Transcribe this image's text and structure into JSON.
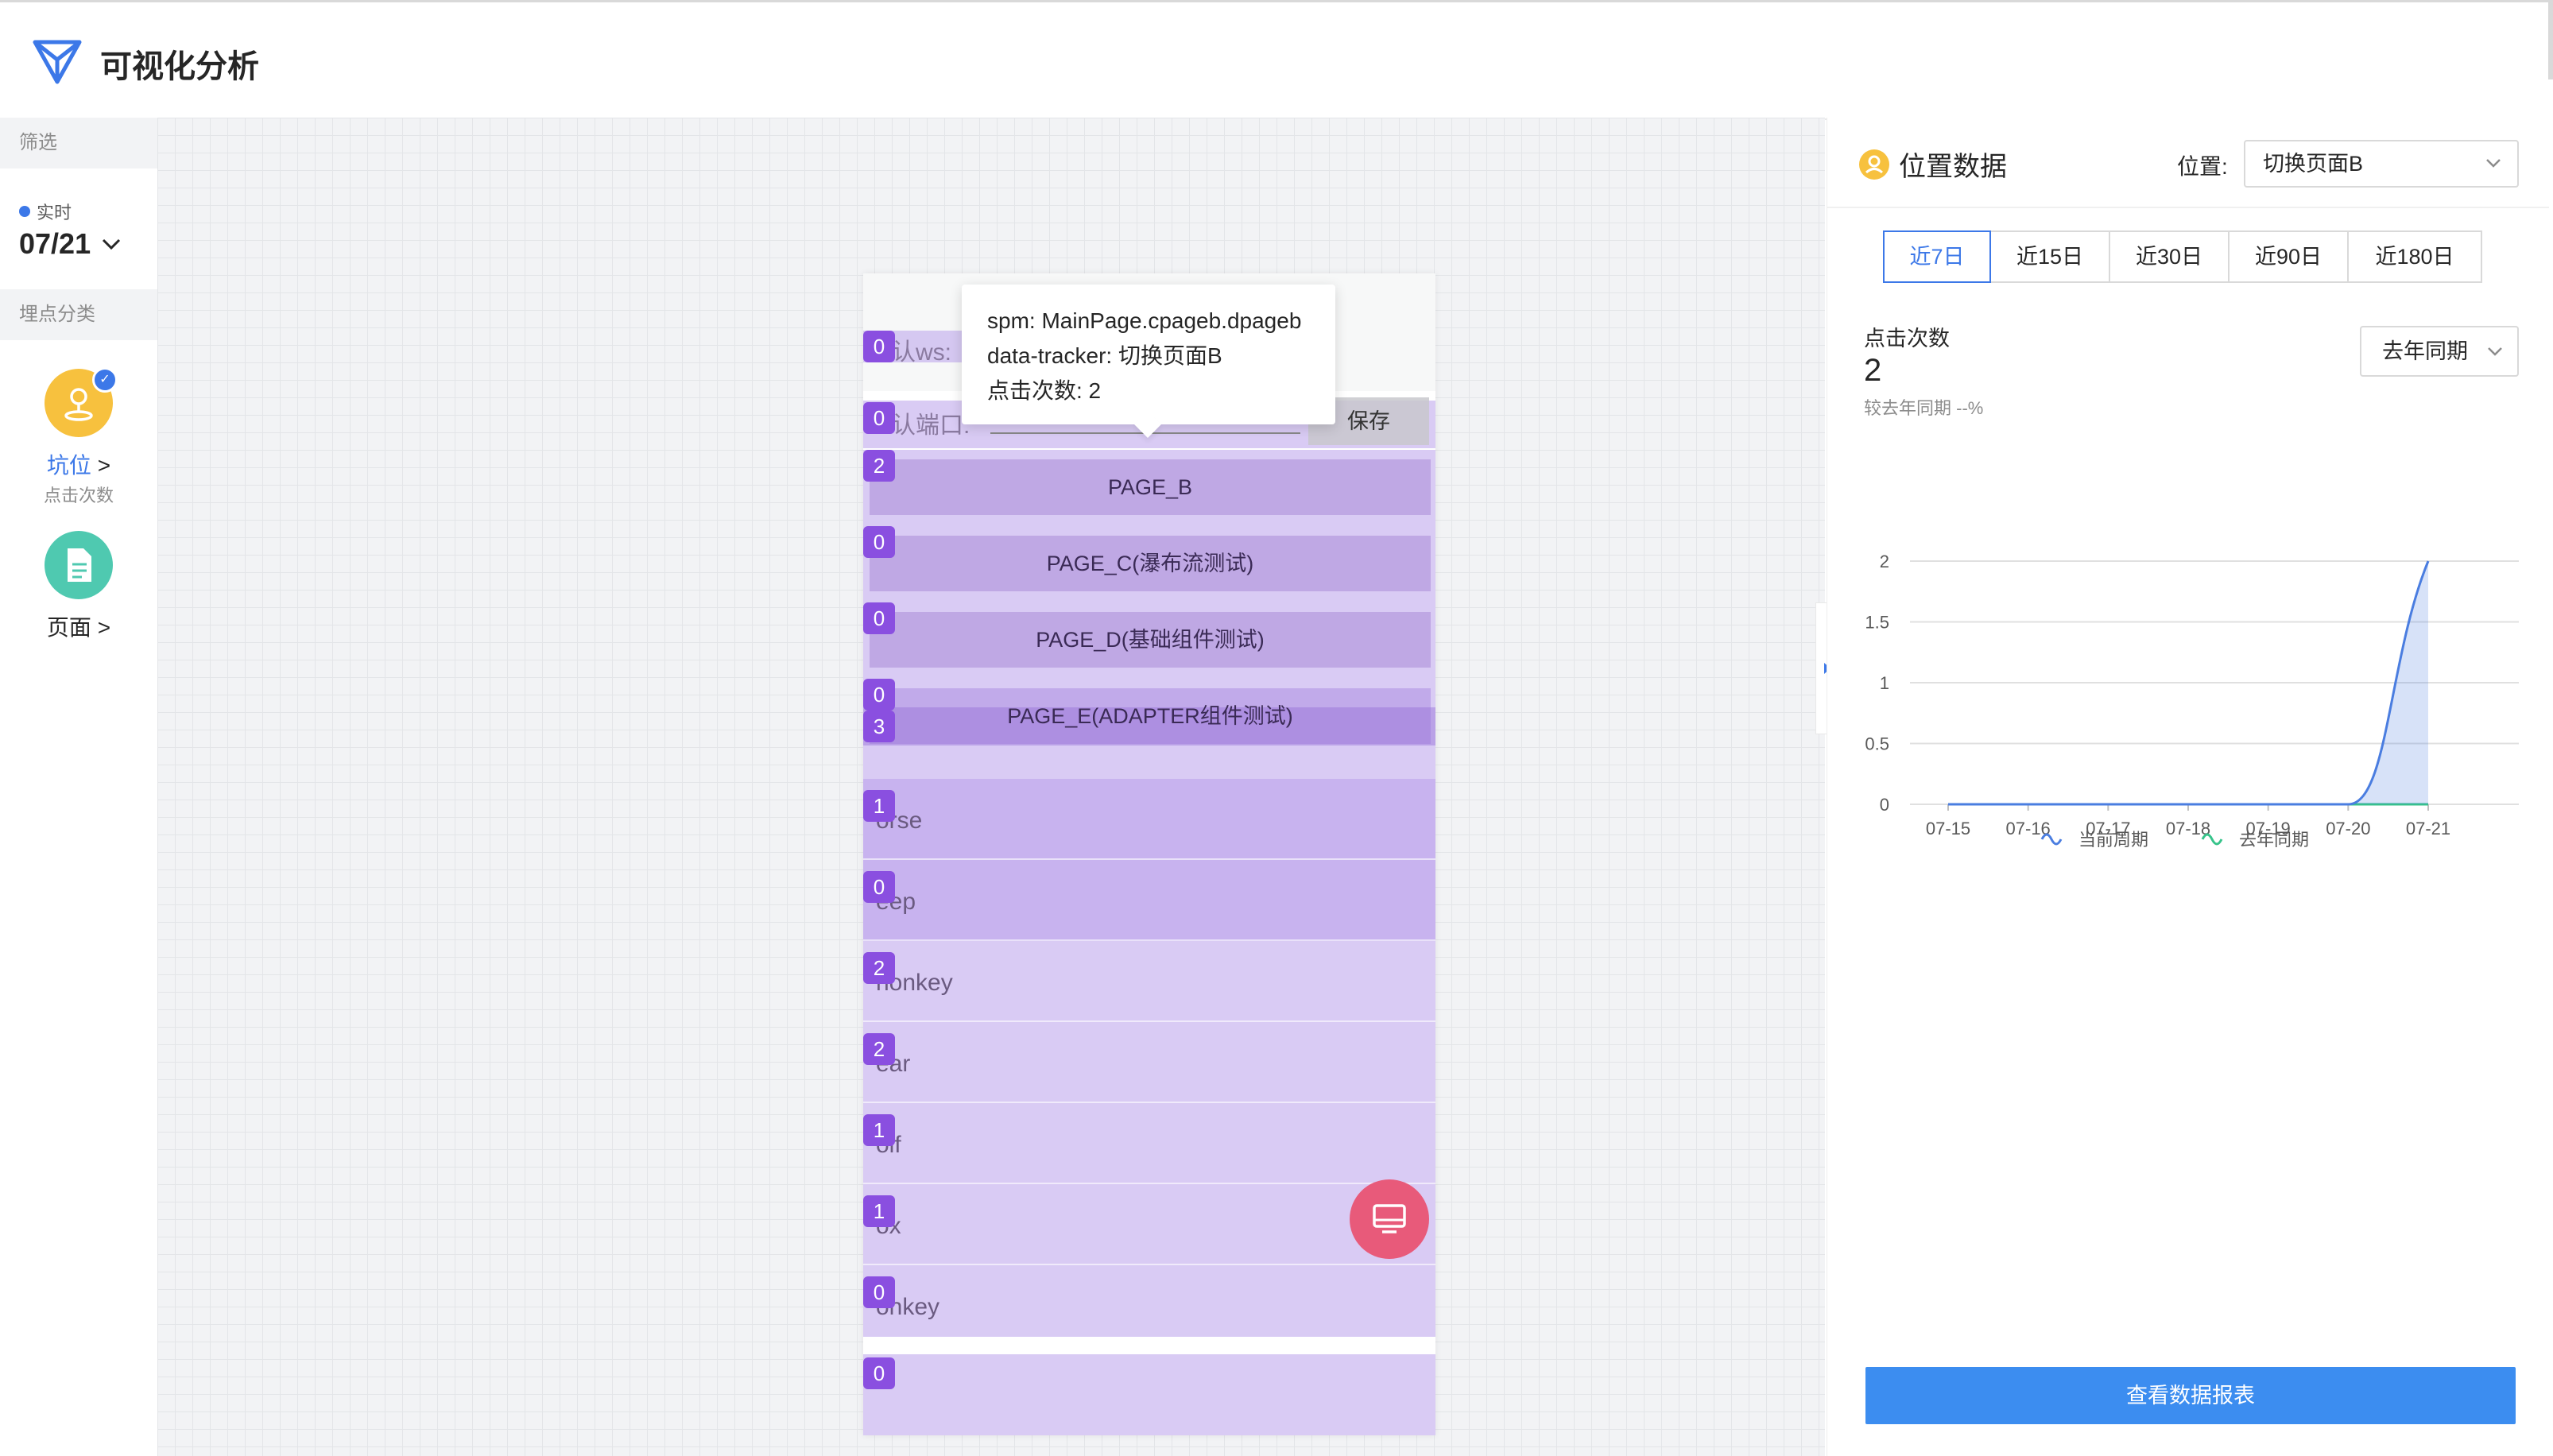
{
  "app": {
    "title": "可视化分析"
  },
  "sidebar": {
    "filter_title": "筛选",
    "realtime_label": "实时",
    "date": "07/21",
    "category_title": "埋点分类",
    "categories": [
      {
        "label": "坑位",
        "arrow": ">",
        "sub": "点击次数",
        "icon": "location-pin-icon",
        "color": "#f7c13e"
      },
      {
        "label": "页面",
        "arrow": ">",
        "icon": "document-icon",
        "color": "#4fc9b0"
      }
    ]
  },
  "phone": {
    "top_rows": [
      {
        "badge": "0",
        "text": "认ws:"
      },
      {
        "badge": "0",
        "text": "认端口:"
      }
    ],
    "save_label": "保存",
    "buttons": [
      {
        "badge": "2",
        "label": "PAGE_B"
      },
      {
        "badge": "0",
        "label": "PAGE_C(瀑布流测试)"
      },
      {
        "badge": "0",
        "label": "PAGE_D(基础组件测试)"
      },
      {
        "badge": "0",
        "label": "PAGE_E(ADAPTER组件测试)",
        "badge2": "3"
      }
    ],
    "list": [
      {
        "badge": "1",
        "text": "orse"
      },
      {
        "badge": "0",
        "text": "eep"
      },
      {
        "badge": "2",
        "text": "nonkey"
      },
      {
        "badge": "2",
        "text": "ear"
      },
      {
        "badge": "1",
        "text": "olf"
      },
      {
        "badge": "1",
        "text": "ox"
      },
      {
        "badge": "0",
        "text": "onkey"
      }
    ],
    "bottom_badge": "0"
  },
  "tooltip": {
    "spm": "spm: MainPage.cpageb.dpageb",
    "tracker": "data-tracker: 切换页面B",
    "clicks": "点击次数: 2"
  },
  "panel": {
    "title": "位置数据",
    "position_label": "位置:",
    "position_value": "切换页面B",
    "tabs": [
      "近7日",
      "近15日",
      "近30日",
      "近90日",
      "近180日"
    ],
    "active_tab": 0,
    "metric_label": "点击次数",
    "metric_value": "2",
    "metric_sub": "较去年同期 --%",
    "compare_select": "去年同期",
    "report_button": "查看数据报表"
  },
  "colors": {
    "accent": "#3c78e8",
    "series_current": "#4a7de0",
    "series_last": "#36c38a"
  },
  "chart_data": {
    "type": "area",
    "x": [
      "07-15",
      "07-16",
      "07-17",
      "07-18",
      "07-19",
      "07-20",
      "07-21"
    ],
    "yticks": [
      "0",
      "0.5",
      "1",
      "1.5",
      "2"
    ],
    "ylim": [
      0,
      2
    ],
    "series": [
      {
        "name": "当前周期",
        "values": [
          0,
          0,
          0,
          0,
          0,
          0,
          2
        ]
      },
      {
        "name": "去年同期",
        "values": [
          0,
          0,
          0,
          0,
          0,
          0,
          0
        ]
      }
    ],
    "grid": true,
    "legend": "bottom"
  }
}
